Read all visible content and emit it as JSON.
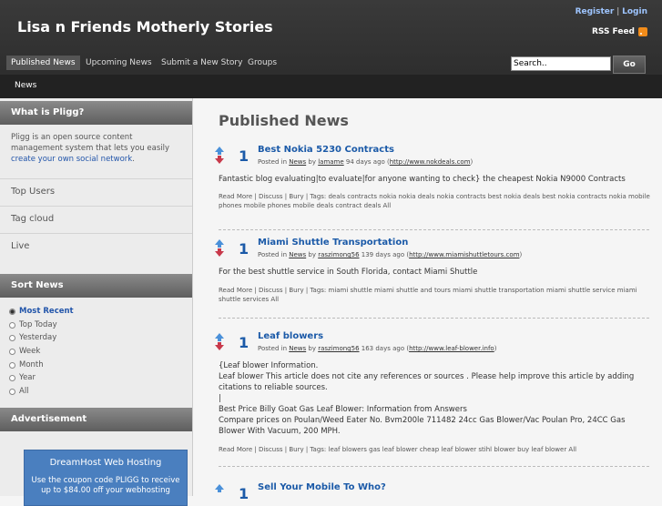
{
  "header": {
    "site_title": "Lisa n Friends Motherly Stories",
    "register": "Register",
    "divider": "|",
    "login": "Login",
    "rss": "RSS Feed"
  },
  "nav": {
    "items": [
      "Published News",
      "Upcoming News",
      "Submit a New Story",
      "Groups"
    ],
    "search_value": "Search..",
    "go": "Go",
    "sub": "News"
  },
  "sidebar": {
    "what_is_head": "What is Pligg?",
    "what_is_text": "Pligg is an open source content management system that lets you easily ",
    "what_is_link": "create your own social network",
    "what_is_end": ".",
    "links": [
      "Top Users",
      "Tag cloud",
      "Live"
    ],
    "sort_head": "Sort News",
    "sort_items": [
      "Most Recent",
      "Top Today",
      "Yesterday",
      "Week",
      "Month",
      "Year",
      "All"
    ],
    "ad_head": "Advertisement",
    "ad_title": "DreamHost Web Hosting",
    "ad_text": "Use the coupon code PLIGG to receive up to $84.00 off your webhosting"
  },
  "main": {
    "title": "Published News",
    "stories": [
      {
        "votes": "1",
        "title": "Best Nokia 5230 Contracts",
        "meta_posted": "Posted in ",
        "category": "News",
        "meta_by": " by ",
        "author": "lamame",
        "meta_ago": " 94 days ago (",
        "url": "http://www.nokdeals.com",
        "meta_close": ")",
        "body": [
          "Fantastic blog evaluating|to evaluate|for anyone wanting to check} the cheapest Nokia N9000 Contracts"
        ],
        "tags_line": "Read More | Discuss | Bury | Tags: deals contracts nokia nokia deals nokia contracts best nokia deals best nokia contracts nokia mobile phones mobile phones mobile deals contract deals All"
      },
      {
        "votes": "1",
        "title": "Miami Shuttle Transportation",
        "meta_posted": "Posted in ",
        "category": "News",
        "meta_by": " by ",
        "author": "raszimong56",
        "meta_ago": " 139 days ago (",
        "url": "http://www.miamishuttletours.com",
        "meta_close": ")",
        "body": [
          "For the best shuttle service in South Florida, contact Miami Shuttle"
        ],
        "tags_line": "Read More | Discuss | Bury | Tags: miami shuttle miami shuttle and tours miami shuttle transportation miami shuttle service miami shuttle services All"
      },
      {
        "votes": "1",
        "title": "Leaf blowers",
        "meta_posted": "Posted in ",
        "category": "News",
        "meta_by": " by ",
        "author": "raszimong56",
        "meta_ago": " 163 days ago (",
        "url": "http://www.leaf-blower.info",
        "meta_close": ")",
        "body": [
          "{Leaf blower Information.",
          "Leaf blower This article does not cite any references or sources . Please help improve this article by adding citations to reliable sources.",
          "|",
          "Best Price Billy Goat Gas Leaf Blower: Information from Answers",
          "Compare prices on Poulan/Weed Eater No. Bvm200le 711482 24cc Gas Blower/Vac Poulan Pro, 24CC Gas Blower With Vacuum, 200 MPH."
        ],
        "tags_line": "Read More | Discuss | Bury | Tags: leaf blowers gas leaf blower cheap leaf blower stihl blower buy leaf blower All"
      },
      {
        "votes": "1",
        "title": "Sell Your Mobile To Who?"
      }
    ]
  }
}
